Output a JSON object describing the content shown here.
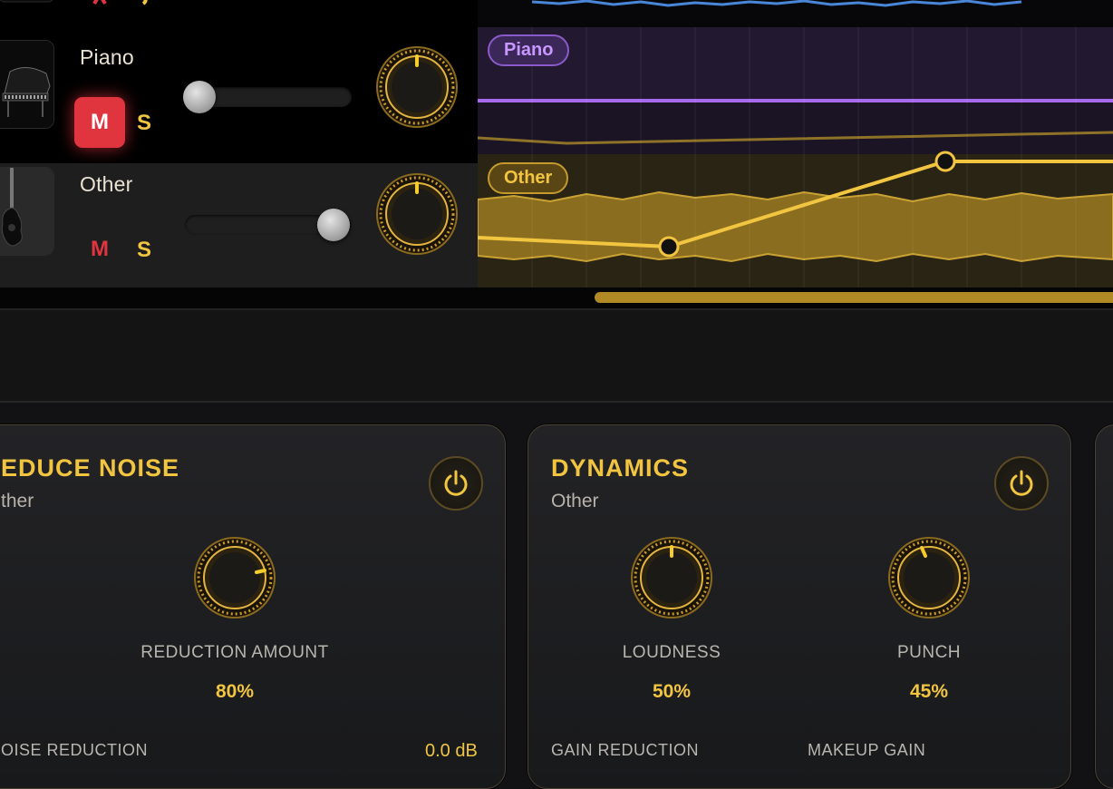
{
  "tracks": {
    "piano": {
      "name": "Piano",
      "mute": "M",
      "solo": "S",
      "tag": "Piano",
      "volume": 0.05,
      "mute_active": true
    },
    "other": {
      "name": "Other",
      "mute": "M",
      "solo": "S",
      "tag": "Other",
      "volume": 0.9,
      "mute_active": false
    }
  },
  "colors": {
    "accent_gold": "#f2c541",
    "mute_red": "#e0343f",
    "piano_lane": "#a86bf0",
    "other_lane": "#e9b83a"
  },
  "panels": {
    "reduce_noise": {
      "title": "EDUCE NOISE",
      "subtitle": "ther",
      "param": {
        "label": "REDUCTION AMOUNT",
        "value": "80%"
      },
      "footer": {
        "label": "OISE REDUCTION",
        "value": "0.0 dB"
      }
    },
    "dynamics": {
      "title": "DYNAMICS",
      "subtitle": "Other",
      "params": [
        {
          "label": "LOUDNESS",
          "value": "50%"
        },
        {
          "label": "PUNCH",
          "value": "45%"
        }
      ],
      "footer": [
        {
          "label": "GAIN REDUCTION"
        },
        {
          "label": "MAKEUP GAIN"
        }
      ]
    }
  }
}
